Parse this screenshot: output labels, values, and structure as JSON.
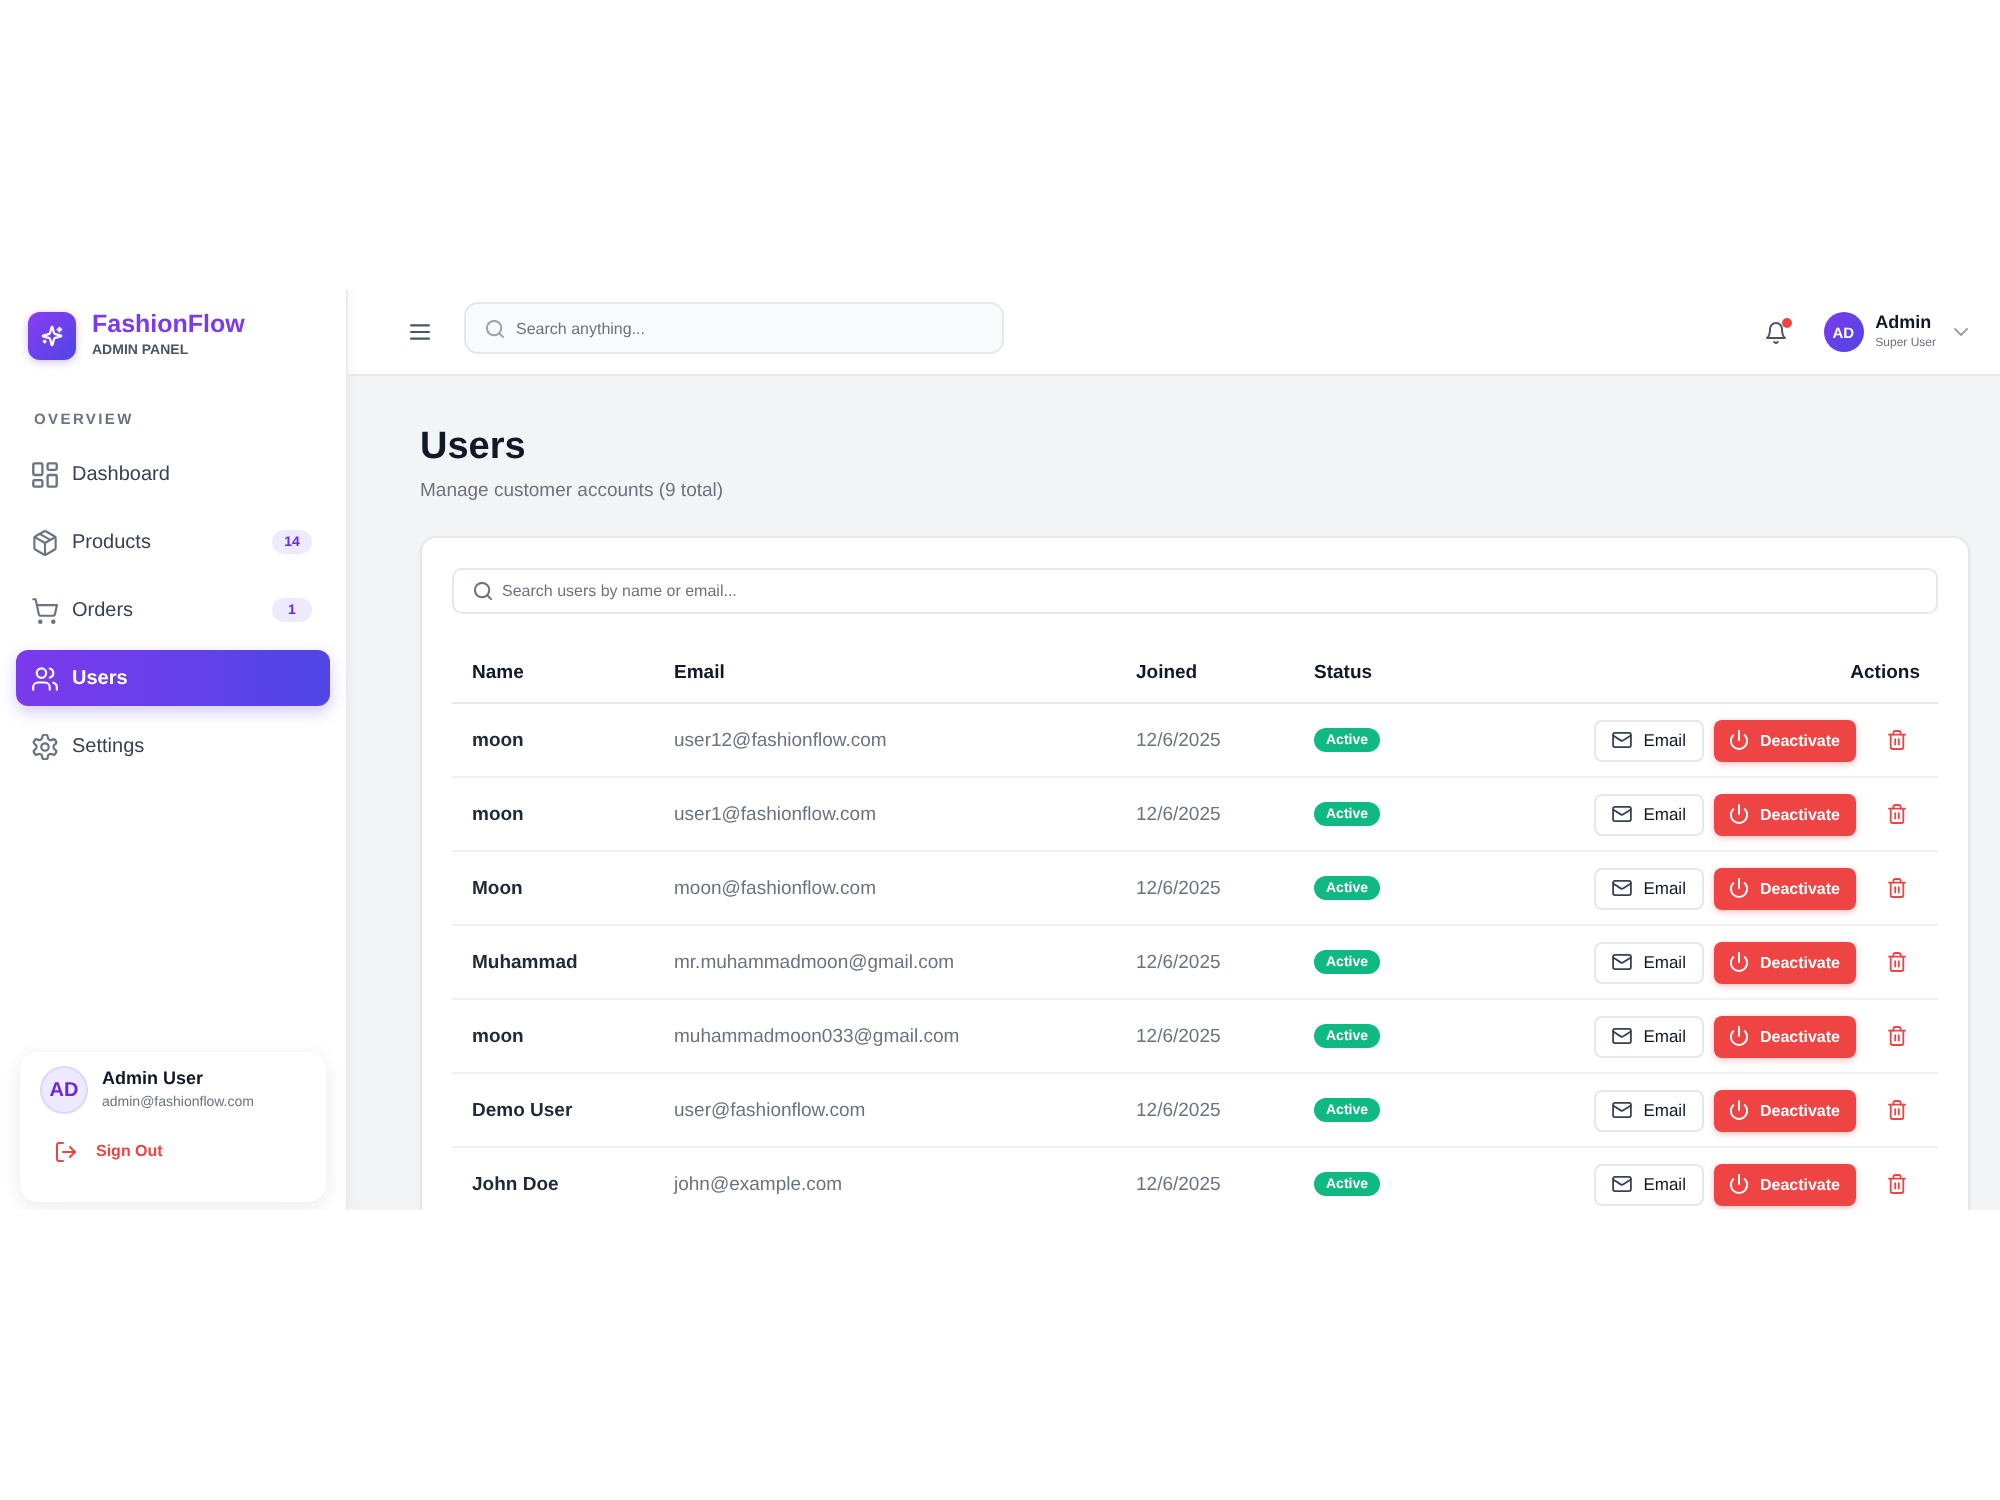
{
  "sidebar": {
    "brand": {
      "name": "FashionFlow",
      "subtitle": "ADMIN PANEL"
    },
    "section_label": "OVERVIEW",
    "items": [
      {
        "kind": "dashboard",
        "label": "Dashboard",
        "selected": false
      },
      {
        "kind": "products",
        "label": "Products",
        "badge": "14",
        "selected": false
      },
      {
        "kind": "orders",
        "label": "Orders",
        "badge": "1",
        "selected": false
      },
      {
        "kind": "users",
        "label": "Users",
        "selected": true
      },
      {
        "kind": "settings",
        "label": "Settings",
        "selected": false
      }
    ],
    "user": {
      "initials": "AD",
      "name": "Admin User",
      "email": "admin@fashionflow.com",
      "sign_out": "Sign Out"
    }
  },
  "topbar": {
    "search": {
      "placeholder": "Search anything..."
    },
    "notifications": {
      "unread": true
    },
    "user": {
      "initials": "AD",
      "name": "Admin",
      "role": "Super User"
    }
  },
  "page": {
    "title": "Users",
    "subtitle": "Manage customer accounts (9 total)"
  },
  "users_table": {
    "search": {
      "placeholder": "Search users by name or email..."
    },
    "columns": [
      "Name",
      "Email",
      "Joined",
      "Status",
      "Actions"
    ],
    "rows": [
      {
        "name": "moon",
        "email": "user12@fashionflow.com",
        "joined": "12/6/2025",
        "status": "Active",
        "actions": [
          {
            "kind": "email",
            "label": "Email"
          },
          {
            "kind": "deactivate",
            "label": "Deactivate"
          },
          {
            "kind": "delete"
          }
        ]
      },
      {
        "name": "moon",
        "email": "user1@fashionflow.com",
        "joined": "12/6/2025",
        "status": "Active",
        "actions": [
          {
            "kind": "email",
            "label": "Email"
          },
          {
            "kind": "deactivate",
            "label": "Deactivate"
          },
          {
            "kind": "delete"
          }
        ]
      },
      {
        "name": "Moon",
        "email": "moon@fashionflow.com",
        "joined": "12/6/2025",
        "status": "Active",
        "actions": [
          {
            "kind": "email",
            "label": "Email"
          },
          {
            "kind": "deactivate",
            "label": "Deactivate"
          },
          {
            "kind": "delete"
          }
        ]
      },
      {
        "name": "Muhammad",
        "email": "mr.muhammadmoon@gmail.com",
        "joined": "12/6/2025",
        "status": "Active",
        "actions": [
          {
            "kind": "email",
            "label": "Email"
          },
          {
            "kind": "deactivate",
            "label": "Deactivate"
          },
          {
            "kind": "delete"
          }
        ]
      },
      {
        "name": "moon",
        "email": "muhammadmoon033@gmail.com",
        "joined": "12/6/2025",
        "status": "Active",
        "actions": [
          {
            "kind": "email",
            "label": "Email"
          },
          {
            "kind": "deactivate",
            "label": "Deactivate"
          },
          {
            "kind": "delete"
          }
        ]
      },
      {
        "name": "Demo User",
        "email": "user@fashionflow.com",
        "joined": "12/6/2025",
        "status": "Active",
        "actions": [
          {
            "kind": "email",
            "label": "Email"
          },
          {
            "kind": "deactivate",
            "label": "Deactivate"
          },
          {
            "kind": "delete"
          }
        ]
      },
      {
        "name": "John Doe",
        "email": "john@example.com",
        "joined": "12/6/2025",
        "status": "Active",
        "actions": [
          {
            "kind": "email",
            "label": "Email"
          },
          {
            "kind": "deactivate",
            "label": "Deactivate"
          },
          {
            "kind": "delete"
          }
        ]
      }
    ]
  }
}
